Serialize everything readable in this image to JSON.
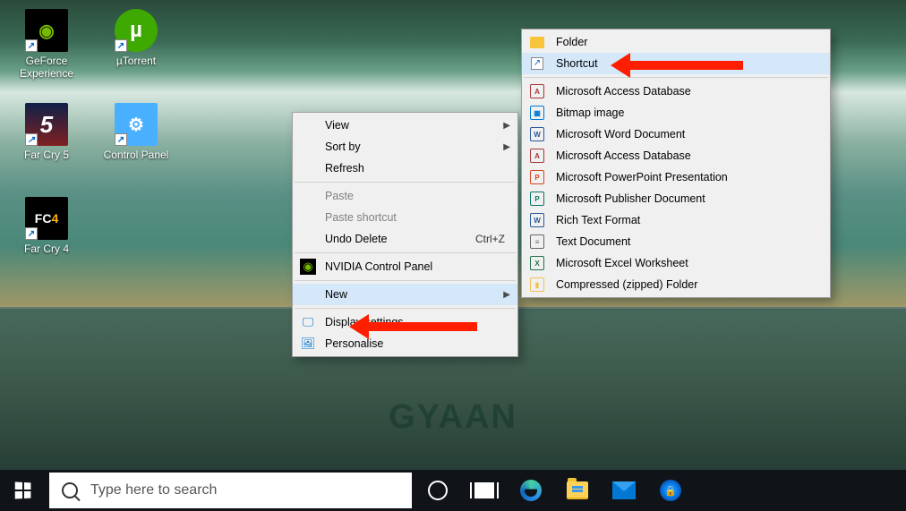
{
  "desktop_icons": [
    {
      "label": "GeForce Experience",
      "bg": "#000",
      "fg": "#76b900",
      "glyph": "◉"
    },
    {
      "label": "µTorrent",
      "bg": "#3ea900",
      "fg": "#fff",
      "glyph": "µ"
    },
    {
      "label": "Far Cry 5",
      "bg": "#10204a",
      "fg": "#fff",
      "glyph": "5"
    },
    {
      "label": "Control Panel",
      "bg": "#2196f3",
      "fg": "#fff",
      "glyph": "⚙"
    },
    {
      "label": "Far Cry 4",
      "bg": "#000",
      "fg": "#ffb400",
      "glyph": "FC4"
    }
  ],
  "context_menu": {
    "view": "View",
    "sort_by": "Sort by",
    "refresh": "Refresh",
    "paste": "Paste",
    "paste_shortcut": "Paste shortcut",
    "undo_delete": "Undo Delete",
    "undo_hotkey": "Ctrl+Z",
    "nvidia": "NVIDIA Control Panel",
    "new": "New",
    "display": "Display settings",
    "personalise": "Personalise"
  },
  "new_submenu": [
    {
      "label": "Folder",
      "icon": "folder",
      "color": "#f8c43c"
    },
    {
      "label": "Shortcut",
      "icon": "shortcut",
      "color": "#0066cc",
      "highlighted": true
    },
    {
      "sep": true
    },
    {
      "label": "Microsoft Access Database",
      "icon": "A",
      "color": "#a4373a"
    },
    {
      "label": "Bitmap image",
      "icon": "▦",
      "color": "#0078d4"
    },
    {
      "label": "Microsoft Word Document",
      "icon": "W",
      "color": "#2b579a"
    },
    {
      "label": "Microsoft Access Database",
      "icon": "A",
      "color": "#a4373a"
    },
    {
      "label": "Microsoft PowerPoint Presentation",
      "icon": "P",
      "color": "#d24726"
    },
    {
      "label": "Microsoft Publisher Document",
      "icon": "P",
      "color": "#077568"
    },
    {
      "label": "Rich Text Format",
      "icon": "W",
      "color": "#2b579a"
    },
    {
      "label": "Text Document",
      "icon": "≡",
      "color": "#666"
    },
    {
      "label": "Microsoft Excel Worksheet",
      "icon": "X",
      "color": "#217346"
    },
    {
      "label": "Compressed (zipped) Folder",
      "icon": "▮",
      "color": "#f0c050"
    }
  ],
  "taskbar": {
    "search_placeholder": "Type here to search"
  },
  "watermark": "GYAAN"
}
